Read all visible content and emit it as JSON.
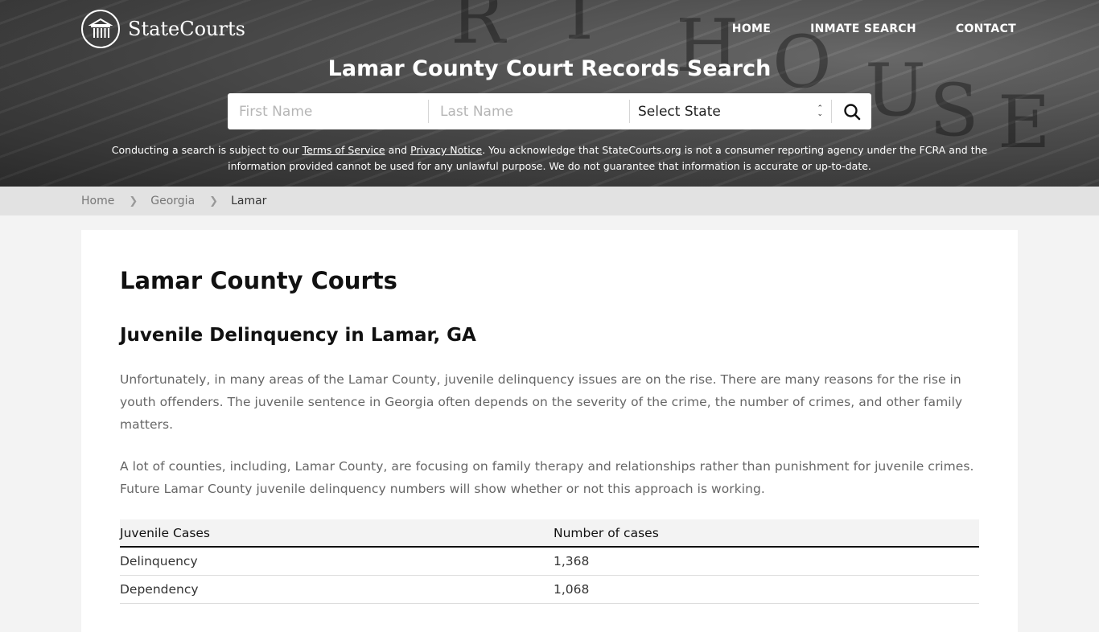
{
  "header": {
    "logo_text": "StateCourts",
    "nav": [
      {
        "label": "HOME"
      },
      {
        "label": "INMATE SEARCH"
      },
      {
        "label": "CONTACT"
      }
    ],
    "hero_title": "Lamar County Court Records Search",
    "background_letters": [
      "R",
      "T",
      "H",
      "O",
      "U",
      "S",
      "E"
    ]
  },
  "search": {
    "first_name_placeholder": "First Name",
    "last_name_placeholder": "Last Name",
    "state_selected": "Select State",
    "search_icon": "search-icon"
  },
  "disclaimer": {
    "prefix": "Conducting a search is subject to our ",
    "terms_link": "Terms of Service",
    "and": " and ",
    "privacy_link": "Privacy Notice",
    "suffix": ". You acknowledge that StateCourts.org is not a consumer reporting agency under the FCRA and the information provided cannot be used for any unlawful purpose. We do not guarantee that information is accurate or up-to-date."
  },
  "breadcrumb": [
    {
      "label": "Home"
    },
    {
      "label": "Georgia"
    },
    {
      "label": "Lamar"
    }
  ],
  "main": {
    "title": "Lamar County Courts",
    "section_title": "Juvenile Delinquency in Lamar, GA",
    "paragraphs": [
      "Unfortunately, in many areas of the Lamar County, juvenile delinquency issues are on the rise. There are many reasons for the rise in youth offenders. The juvenile sentence in Georgia often depends on the severity of the crime, the number of crimes, and other family matters.",
      "A lot of counties, including, Lamar County, are focusing on family therapy and relationships rather than punishment for juvenile crimes. Future Lamar County juvenile delinquency numbers will show whether or not this approach is working."
    ],
    "table": {
      "headers": [
        "Juvenile Cases",
        "Number of cases"
      ],
      "rows": [
        [
          "Delinquency",
          "1,368"
        ],
        [
          "Dependency",
          "1,068"
        ]
      ]
    }
  }
}
